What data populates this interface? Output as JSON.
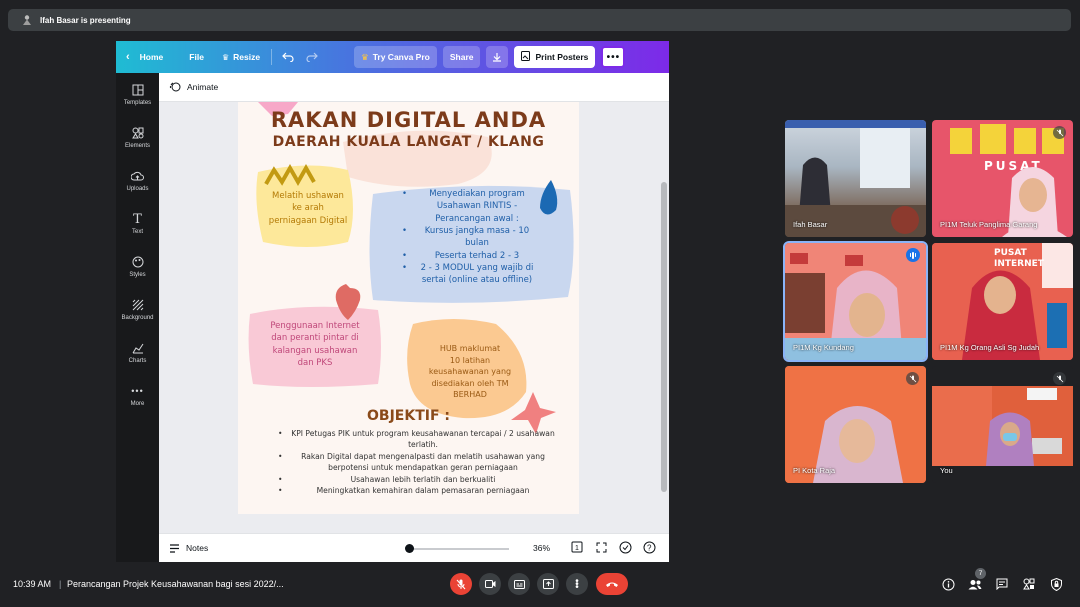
{
  "presenting_bar": {
    "text": "Ifah Basar is presenting"
  },
  "canva": {
    "toolbar": {
      "home": "Home",
      "file": "File",
      "resize": "Resize",
      "try_pro": "Try Canva Pro",
      "share": "Share",
      "print": "Print Posters"
    },
    "sidebar": [
      {
        "label": "Templates",
        "icon": "templates-icon"
      },
      {
        "label": "Elements",
        "icon": "elements-icon"
      },
      {
        "label": "Uploads",
        "icon": "uploads-icon"
      },
      {
        "label": "Text",
        "icon": "text-icon"
      },
      {
        "label": "Styles",
        "icon": "styles-icon"
      },
      {
        "label": "Background",
        "icon": "background-icon"
      },
      {
        "label": "Charts",
        "icon": "charts-icon"
      },
      {
        "label": "More",
        "icon": "more-icon"
      }
    ],
    "animate": "Animate",
    "notes": "Notes",
    "zoom": "36%",
    "zoom_level": 0.0
  },
  "poster": {
    "title": "RAKAN DIGITAL ANDA",
    "subtitle": "DAERAH KUALA LANGAT / KLANG",
    "yellow": [
      "Melatih ushawan",
      "ke arah",
      "perniagaan Digital"
    ],
    "blue": [
      {
        "text": "Menyediakan program",
        "bullet": true
      },
      {
        "text": "Usahawan RINTIS -",
        "bullet": false
      },
      {
        "text": "Perancangan awal :",
        "bullet": false
      },
      {
        "text": "Kursus jangka masa - 10",
        "bullet": true
      },
      {
        "text": "bulan",
        "bullet": false
      },
      {
        "text": "Peserta terhad 2 - 3",
        "bullet": true
      },
      {
        "text": "2 - 3 MODUL yang wajib di",
        "bullet": true
      },
      {
        "text": "sertai (online atau offline)",
        "bullet": false
      }
    ],
    "pink": [
      "Penggunaan Internet",
      "dan peranti pintar di",
      "kalangan usahawan",
      "dan PKS"
    ],
    "orange": [
      "HUB maklumat",
      "10 latihan",
      "keusahawanan yang",
      "disediakan oleh TM",
      "BERHAD"
    ],
    "objektif_title": "OBJEKTIF :",
    "objektif": [
      "KPI Petugas PIK untuk program keusahawanan tercapai / 2 usahawan terlatih.",
      "Rakan Digital dapat mengenalpasti dan melatih usahawan yang berpotensi untuk mendapatkan geran perniagaan",
      "Usahawan lebih terlatih dan berkualiti",
      "Meningkatkan kemahiran dalam pemasaran perniagaan"
    ]
  },
  "participants": [
    {
      "name": "Ifah Basar",
      "muted": false
    },
    {
      "name": "PI1M Teluk Panglima Garang",
      "muted": true
    },
    {
      "name": "PI1M Kg Kundang",
      "muted": false,
      "speaking": true
    },
    {
      "name": "PI1M Kg Orang Asli Sg Judah",
      "muted": false
    },
    {
      "name": "PI Kota Raja",
      "muted": true
    },
    {
      "name": "You",
      "muted": true
    }
  ],
  "bottom_bar": {
    "time": "10:39 AM",
    "separator": "|",
    "meeting_title": "Perancangan Projek Keusahawanan bagi sesi 2022/...",
    "people_count": "7"
  },
  "colors": {
    "background": "#202124",
    "end_call": "#ea4335",
    "canva_gradient_start": "#1fbcd3",
    "canva_gradient_end": "#7d2ae8"
  }
}
